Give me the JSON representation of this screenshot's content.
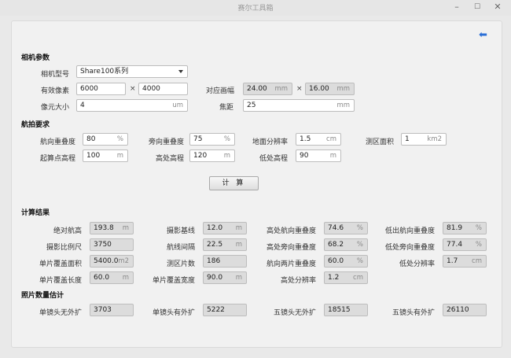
{
  "window": {
    "title": "赛尔工具箱"
  },
  "camera": {
    "section": "相机参数",
    "model_label": "相机型号",
    "model_value": "Share100系列",
    "pixels_label": "有效像素",
    "pixels_w": "6000",
    "pixels_h": "4000",
    "frame_label": "对应画幅",
    "frame_w": "24.00",
    "frame_h": "16.00",
    "frame_unit": "mm",
    "pixel_size_label": "像元大小",
    "pixel_size": "4",
    "pixel_size_unit": "um",
    "focal_label": "焦距",
    "focal": "25",
    "focal_unit": "mm",
    "times": "×"
  },
  "flight": {
    "section": "航拍要求",
    "rows": [
      [
        {
          "label": "航向重叠度",
          "value": "80",
          "unit": "%"
        },
        {
          "label": "旁向重叠度",
          "value": "75",
          "unit": "%"
        },
        {
          "label": "地面分辨率",
          "value": "1.5",
          "unit": "cm"
        },
        {
          "label": "测区面积",
          "value": "1",
          "unit": "km2"
        }
      ],
      [
        {
          "label": "起算点高程",
          "value": "100",
          "unit": "m"
        },
        {
          "label": "高处高程",
          "value": "120",
          "unit": "m"
        },
        {
          "label": "低处高程",
          "value": "90",
          "unit": "m"
        }
      ]
    ],
    "calc_button": "计 算"
  },
  "results": {
    "section": "计算结果",
    "rows": [
      [
        {
          "label": "绝对航高",
          "value": "193.8",
          "unit": "m"
        },
        {
          "label": "摄影基线",
          "value": "12.0",
          "unit": "m"
        },
        {
          "label": "高处航向重叠度",
          "value": "74.6",
          "unit": "%"
        },
        {
          "label": "低出航向重叠度",
          "value": "81.9",
          "unit": "%"
        }
      ],
      [
        {
          "label": "摄影比例尺",
          "value": "3750",
          "unit": ""
        },
        {
          "label": "航线间隔",
          "value": "22.5",
          "unit": "m"
        },
        {
          "label": "高处旁向重叠度",
          "value": "68.2",
          "unit": "%"
        },
        {
          "label": "低处旁向重叠度",
          "value": "77.4",
          "unit": "%"
        }
      ],
      [
        {
          "label": "单片覆盖面积",
          "value": "5400.0",
          "unit": "m2"
        },
        {
          "label": "测区片数",
          "value": "186",
          "unit": ""
        },
        {
          "label": "航向两片重叠度",
          "value": "60.0",
          "unit": "%"
        },
        {
          "label": "低处分辨率",
          "value": "1.7",
          "unit": "cm"
        }
      ],
      [
        {
          "label": "单片覆盖长度",
          "value": "60.0",
          "unit": "m"
        },
        {
          "label": "单片覆盖宽度",
          "value": "90.0",
          "unit": "m"
        },
        {
          "label": "高处分辨率",
          "value": "1.2",
          "unit": "cm"
        }
      ]
    ]
  },
  "photos": {
    "section": "照片数量估计",
    "items": [
      {
        "label": "单镜头无外扩",
        "value": "3703"
      },
      {
        "label": "单镜头有外扩",
        "value": "5222"
      },
      {
        "label": "五镜头无外扩",
        "value": "18515"
      },
      {
        "label": "五镜头有外扩",
        "value": "26110"
      }
    ]
  }
}
